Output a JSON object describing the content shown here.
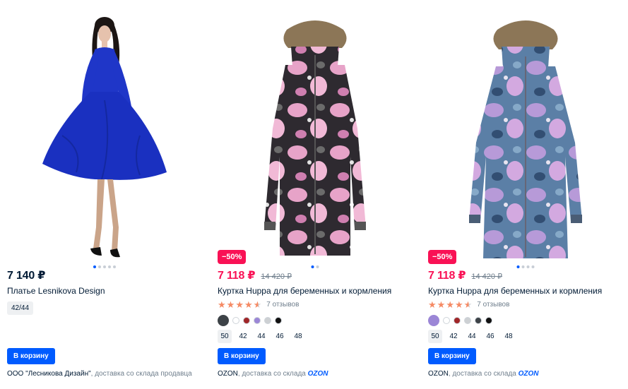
{
  "products": [
    {
      "price": "7 140 ₽",
      "title": "Платье Lesnikova Design",
      "size": "42/44",
      "cart_label": "В корзину",
      "seller_name": "ООО \"Лесникова Дизайн\"",
      "delivery": ", доставка со склада продавца",
      "image": "blue-dress-photo"
    },
    {
      "discount": "−50%",
      "price": "7 118 ₽",
      "old_price": "14 420 ₽",
      "title": "Куртка Huppa для беременных и кормления",
      "reviews": "7 отзывов",
      "rating": 4.5,
      "swatches": [
        "#3d4247",
        "#ffffff",
        "#a02628",
        "#9b86d6",
        "#cdd0d3",
        "#111111"
      ],
      "sizes": [
        "50",
        "42",
        "44",
        "46",
        "48"
      ],
      "cart_label": "В корзину",
      "seller_name": "OZON",
      "delivery": ", доставка со склада ",
      "delivery_brand": "OZON",
      "image": "pink-floral-jacket-photo"
    },
    {
      "discount": "−50%",
      "price": "7 118 ₽",
      "old_price": "14 420 ₽",
      "title": "Куртка Huppa для беременных и кормления",
      "reviews": "7 отзывов",
      "rating": 4.5,
      "swatches": [
        "#9b86d6",
        "#ffffff",
        "#a02628",
        "#cdd0d3",
        "#3d4247",
        "#111111"
      ],
      "sizes": [
        "50",
        "42",
        "44",
        "46",
        "48"
      ],
      "cart_label": "В корзину",
      "seller_name": "OZON",
      "delivery": ", доставка со склада ",
      "delivery_brand": "OZON",
      "image": "blue-floral-jacket-photo"
    }
  ],
  "colors": {
    "accent": "#005bff",
    "sale": "#f91155",
    "star": "#f58a64"
  }
}
